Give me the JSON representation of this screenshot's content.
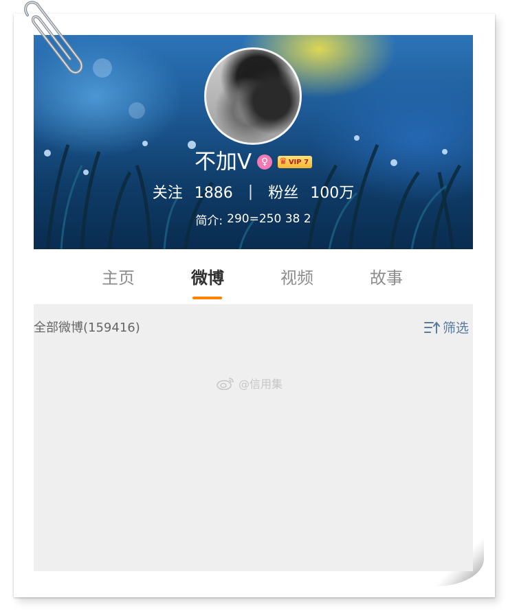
{
  "profile": {
    "name": "不加V",
    "vip_label": "VIP 7",
    "following_label": "关注",
    "following_count": "1886",
    "stats_separator": "|",
    "followers_label": "粉丝",
    "followers_count": "100万",
    "bio_label": "简介:",
    "bio_text": "290=250 38 2"
  },
  "tabs": [
    {
      "label": "主页",
      "active": false
    },
    {
      "label": "微博",
      "active": true
    },
    {
      "label": "视频",
      "active": false
    },
    {
      "label": "故事",
      "active": false
    }
  ],
  "feed": {
    "count_label": "全部微博(159416)",
    "filter_label": "筛选",
    "watermark": "@信用集"
  },
  "colors": {
    "tab_indicator": "#ff8200",
    "filter_text": "#5a7a9e",
    "feed_background": "#efefef",
    "female_badge": "#f07ab4"
  },
  "icons": [
    "paperclip-icon",
    "female-badge-icon",
    "vip-crown-icon",
    "filter-icon",
    "weibo-logo-icon"
  ]
}
